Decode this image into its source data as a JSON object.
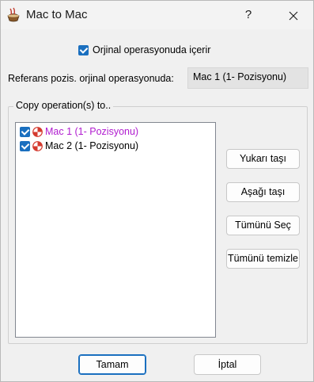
{
  "window": {
    "title": "Mac to Mac",
    "help_label": "?",
    "icons": {
      "app": "pot-app-icon",
      "close": "close-icon"
    }
  },
  "original_op": {
    "label": "Orjinal operasyonuda içerir",
    "checked": true
  },
  "reference": {
    "label": "Referans pozis. orjinal operasyonuda:",
    "value": "Mac 1 (1- Pozisyonu)"
  },
  "copy_group": {
    "title": "Copy operation(s) to..",
    "items": [
      {
        "label": "Mac 1 (1- Pozisyonu)",
        "checked": true,
        "highlighted": true,
        "color": "#b01ccf"
      },
      {
        "label": "Mac 2 (1- Pozisyonu)",
        "checked": true,
        "highlighted": false
      }
    ]
  },
  "side_buttons": {
    "move_up": "Yukarı taşı",
    "move_down": "Aşağı taşı",
    "select_all": "Tümünü Seç",
    "clear_all": "Tümünü temizle"
  },
  "footer": {
    "ok": "Tamam",
    "cancel": "İptal"
  },
  "colors": {
    "accent": "#1a6fbf",
    "highlight_text": "#b01ccf",
    "background": "#f0f0f0"
  }
}
